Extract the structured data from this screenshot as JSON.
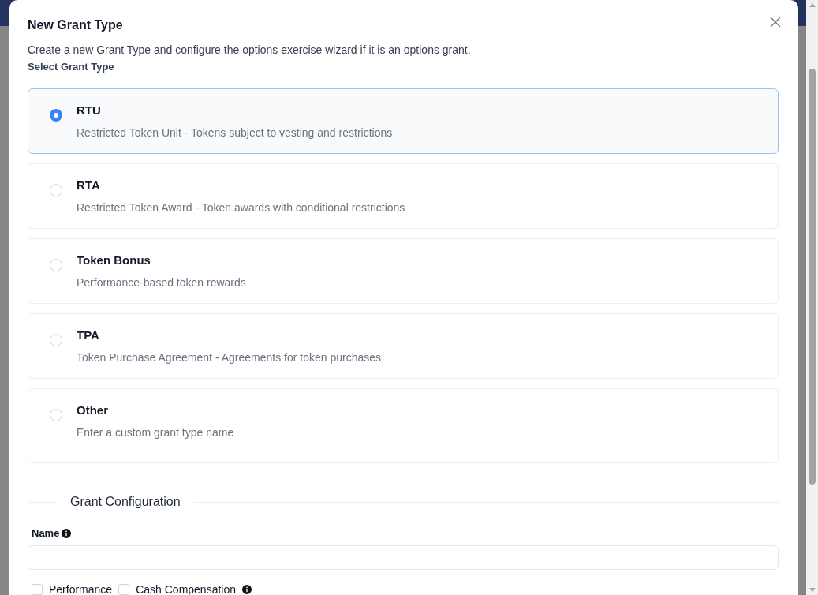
{
  "dialog": {
    "title": "New Grant Type",
    "description": "Create a new Grant Type and configure the options exercise wizard if it is an options grant.",
    "section_label": "Select Grant Type",
    "grant_types": [
      {
        "kind": "preset",
        "title": "RTU",
        "description": "Restricted Token Unit - Tokens subject to vesting and restrictions",
        "selected": true
      },
      {
        "kind": "preset",
        "title": "RTA",
        "description": "Restricted Token Award - Token awards with conditional restrictions",
        "selected": false
      },
      {
        "kind": "preset",
        "title": "Token Bonus",
        "description": "Performance-based token rewards",
        "selected": false
      },
      {
        "kind": "preset",
        "title": "TPA",
        "description": "Token Purchase Agreement - Agreements for token purchases",
        "selected": false
      },
      {
        "kind": "custom",
        "title": "Other",
        "description": "Enter a custom grant type name",
        "selected": false
      }
    ],
    "configuration": {
      "heading": "Grant Configuration",
      "name_field": {
        "label": "Name",
        "info": true
      },
      "options": [
        {
          "label": "Performance",
          "checked": false,
          "info": false
        },
        {
          "label": "Cash Compensation",
          "checked": false,
          "info": true
        }
      ]
    }
  }
}
